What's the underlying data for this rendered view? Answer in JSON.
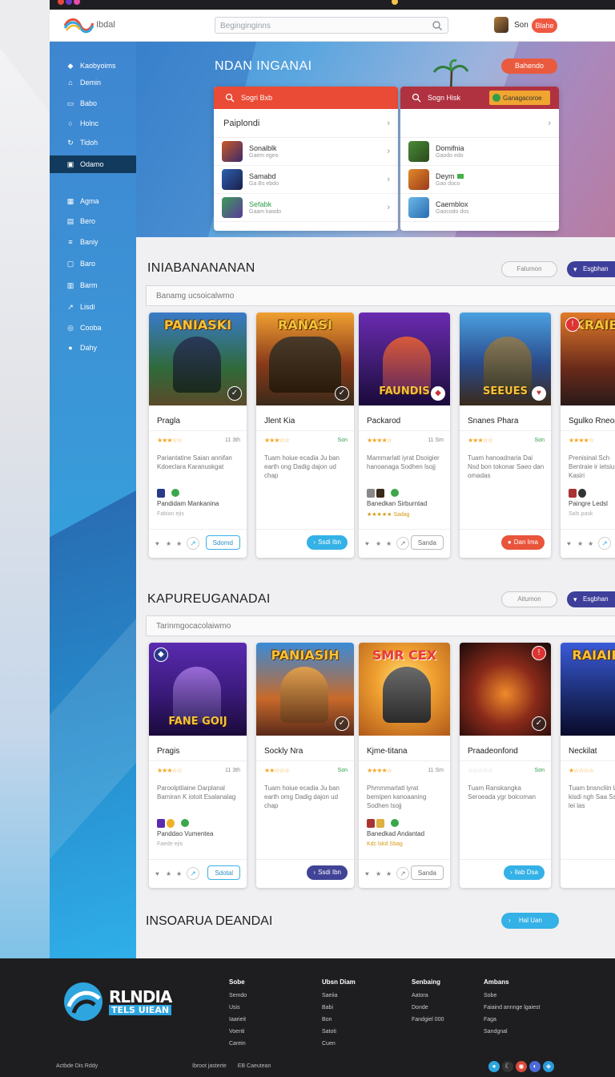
{
  "header": {
    "logo_text": "Ibdal",
    "search_placeholder": "Beginginginns",
    "user_name": "Son",
    "signin_label": "Blahe"
  },
  "sidebar": {
    "items": [
      {
        "label": "Kaobyoims",
        "icon": "gamepad-icon"
      },
      {
        "label": "Demin",
        "icon": "home-icon"
      },
      {
        "label": "Babo",
        "icon": "folder-icon"
      },
      {
        "label": "Holnc",
        "icon": "circle-icon"
      },
      {
        "label": "Tidoh",
        "icon": "refresh-icon"
      },
      {
        "label": "Odamo",
        "icon": "briefcase-icon"
      },
      {
        "label": "Agma",
        "icon": "grid-icon"
      },
      {
        "label": "Bero",
        "icon": "card-icon"
      },
      {
        "label": "Baniy",
        "icon": "list-icon"
      },
      {
        "label": "Baro",
        "icon": "window-icon"
      },
      {
        "label": "Barm",
        "icon": "table-icon"
      },
      {
        "label": "Lisdi",
        "icon": "chart-icon"
      },
      {
        "label": "Cooba",
        "icon": "globe-icon"
      },
      {
        "label": "Dahy",
        "icon": "user-icon"
      }
    ]
  },
  "hero": {
    "title": "NDAN INGANAI",
    "button_label": "Bahendo",
    "left_panel": {
      "search_label": "Sogri Bxb",
      "subheader": "Paiplondi",
      "rows": [
        {
          "name": "Sonalblk",
          "sub": "Gaem egeo"
        },
        {
          "name": "Samabd",
          "sub": "Ga Bs ebdo"
        },
        {
          "name": "Sefabk",
          "sub": "Gaam kaodo"
        }
      ]
    },
    "right_panel": {
      "search_label": "Sogn Hisk",
      "tag_label": "Ganagacoroe",
      "rows": [
        {
          "name": "Domifnia",
          "sub": "Gaodo edo"
        },
        {
          "name": "Deym",
          "sub": "Gao doco"
        },
        {
          "name": "Caemblox",
          "sub": "Gaocodo dos"
        }
      ]
    }
  },
  "sections": [
    {
      "title": "INIABANANANAN",
      "outline_btn": "Falumon",
      "solid_btn": "Esgbhan",
      "filter_text": "Banamg ucsoicalwmo",
      "cards": [
        {
          "art_title": "PANIASKI",
          "art_sub": "",
          "name": "Pragla",
          "stars": "★★★☆☆",
          "meta": "11 3th",
          "desc": "Pariantatine Saian annifan Kdoeclara Karanuskgat",
          "dev": "Pandidam Mankanina",
          "dev_sub": "Fabian ejis",
          "btn": "Sdomd"
        },
        {
          "art_title": "RANASI",
          "art_sub": "",
          "name": "Jlent Kia",
          "stars": "★★★☆☆",
          "meta": "Son",
          "desc": "Tuam hoiue ecadia Ju ban earth ong Dadig dajon ud chap",
          "dev": "",
          "dev_sub": "",
          "btn": "Ssdi Ibn"
        },
        {
          "art_title": "",
          "art_sub": "FAUNDIS",
          "name": "Packarod",
          "stars": "★★★★☆",
          "meta": "11 Sm",
          "desc": "Mammarlatl iyrat Dsoigier hanoanaga Sodhen lsojj",
          "dev": "Banedkan Sirburntad",
          "dev_sub": "Sadag",
          "btn": "Sanda"
        },
        {
          "art_title": "",
          "art_sub": "SEEUES",
          "name": "Snanes Phara",
          "stars": "★★★☆☆",
          "meta": "Son",
          "desc": "Tuam hanoadnaria Dai Nsd bon tokonar Saeo dan omadas",
          "dev": "",
          "dev_sub": "",
          "btn": "Dan Ima"
        },
        {
          "art_title": "KRAIB",
          "art_sub": "",
          "name": "Sgulko Rneoa",
          "stars": "★★★★☆",
          "meta": "",
          "desc": "Prenisinal Sch Bentraie ir ietsiu Kasiri",
          "dev": "Paingre Ledsl",
          "dev_sub": "Sals pask",
          "btn": ""
        }
      ]
    },
    {
      "title": "KAPUREUGANADAI",
      "outline_btn": "Aitumon",
      "solid_btn": "Esgbhan",
      "filter_text": "Tarinmgocacolaiwmo",
      "cards": [
        {
          "art_title": "",
          "art_sub": "FANE GOIJ",
          "name": "Pragis",
          "stars": "★★★☆☆",
          "meta": "11 3th",
          "desc": "Paroolptilaine Darplanal Bamiran K iotoit Esalanalag",
          "dev": "Panddao Vumentea",
          "dev_sub": "Faede ejis",
          "btn": "Sdotal"
        },
        {
          "art_title": "PANIASIH",
          "art_sub": "",
          "name": "Sockly Nra",
          "stars": "★★☆☆☆",
          "meta": "Son",
          "desc": "Tuam hoiue ecadia Ju ban earth omg Dadig dajon ud chap",
          "dev": "",
          "dev_sub": "",
          "btn": "Ssdi Ibn"
        },
        {
          "art_title": "SMR CEX",
          "art_sub": "",
          "name": "Kjme-titana",
          "stars": "★★★★☆",
          "meta": "11 Sm",
          "desc": "Phmmmarlatl iyrat bemipen kanoaaning Sodhen lsojj",
          "dev": "Banedkad Andantad",
          "dev_sub": "Kdc lskd Sbag",
          "btn": "Sanda"
        },
        {
          "art_title": "",
          "art_sub": "",
          "name": "Praadeonfond",
          "stars": "☆☆☆☆☆",
          "meta": "Son",
          "desc": "Tuam Ranskangka Seroeada ygr bolcoman",
          "dev": "",
          "dev_sub": "",
          "btn": "Ilab Dsa"
        },
        {
          "art_title": "RAIAIB",
          "art_sub": "",
          "name": "Neckilat",
          "stars": "★☆☆☆☆",
          "meta": "",
          "desc": "Tuam bnsncliin Lolo kisdi ngh Saa Ssob lei las",
          "dev": "",
          "dev_sub": "",
          "btn": ""
        }
      ]
    }
  ],
  "bottom": {
    "title": "INSOARUA DEANDAI",
    "button_label": "Hal Uan"
  },
  "footer": {
    "brand_line1": "RLNDIA",
    "brand_line2": "TELS UIEAN",
    "columns": [
      {
        "heading": "Sobe",
        "links": [
          "Semdo",
          "Usis",
          "Iaarieit",
          "Voenti",
          "Carein"
        ]
      },
      {
        "heading": "Ubsn Diam",
        "links": [
          "Saeiia",
          "Babi",
          "Bon",
          "Satoti",
          "Cuen"
        ]
      },
      {
        "heading": "Senbaing",
        "links": [
          "Aatora",
          "Donde",
          "Fandgiel 000"
        ]
      },
      {
        "heading": "Ambans",
        "links": [
          "Sobe",
          "Faiaind annnge lgaiest",
          "Faga",
          "Sandgnal"
        ]
      }
    ],
    "copyright": "Actbde Dis Rddy",
    "bottom_links": [
      "Ibroot jasterte",
      "EB Caeutean"
    ]
  }
}
